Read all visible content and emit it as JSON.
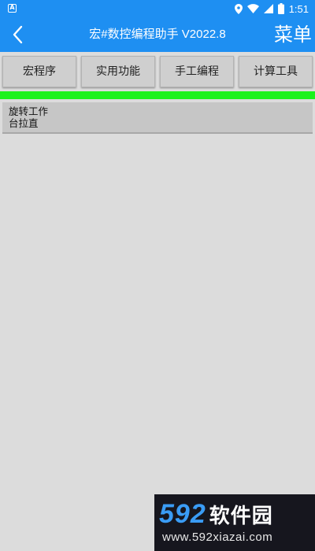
{
  "status_bar": {
    "time": "1:51",
    "icons": [
      "app-notification-icon",
      "location-icon",
      "wifi-icon",
      "signal-icon",
      "battery-icon"
    ]
  },
  "app_bar": {
    "title": "宏#数控编程助手 V2022.8",
    "menu_label": "菜单",
    "back_icon": "chevron-left-icon"
  },
  "tabs": [
    {
      "label": "宏程序"
    },
    {
      "label": "实用功能"
    },
    {
      "label": "手工编程"
    },
    {
      "label": "计算工具"
    }
  ],
  "list": {
    "items": [
      {
        "line1": "旋转工作",
        "line2": "台拉直"
      }
    ]
  },
  "watermark": {
    "digits": "592",
    "brand": "软件园",
    "url": "www.592xiazai.com"
  },
  "colors": {
    "primary": "#1e8ff2",
    "accent_bar": "#1cf21c",
    "background": "#dcdcdc",
    "tab_bg": "#cfcfcf",
    "list_bg": "#c6c6c6"
  }
}
